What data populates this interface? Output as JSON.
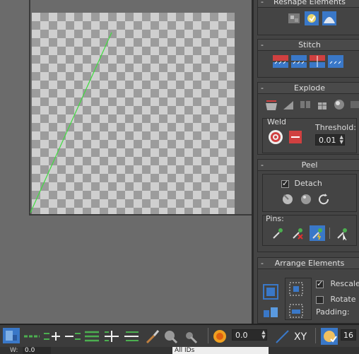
{
  "panel": {
    "reshape": {
      "title": "Reshape Elements"
    },
    "stitch": {
      "title": "Stitch"
    },
    "explode": {
      "title": "Explode",
      "weld_label": "Weld",
      "threshold_label": "Threshold:",
      "threshold_value": "0.01"
    },
    "peel": {
      "title": "Peel",
      "detach_label": "Detach",
      "pins_label": "Pins:"
    },
    "arrange": {
      "title": "Arrange Elements",
      "rescale_label": "Rescale",
      "rotate_label": "Rotate",
      "padding_label": "Padding:"
    },
    "minus_sign": "-"
  },
  "toolbar": {
    "spinner_value": "0.0",
    "xy_label": "XY",
    "count_value": "16",
    "w_label": "W:",
    "w_value": "0.0",
    "ids_value": "All IDs"
  },
  "colors": {
    "uv_edge": "#3fdc3f",
    "accent_blue": "#3a78c8"
  }
}
